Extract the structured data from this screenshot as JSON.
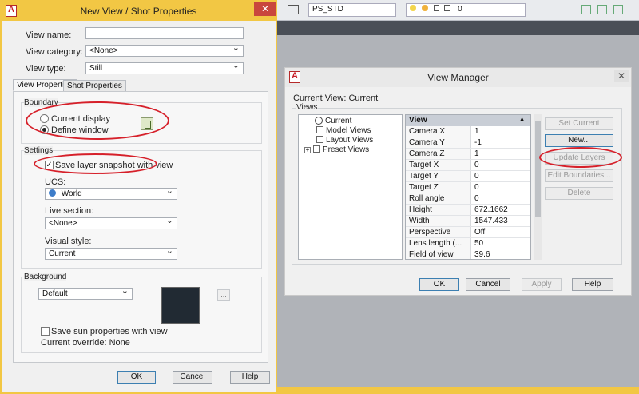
{
  "background": {
    "toolbar": {
      "layer_name": "PS_STD",
      "layer_value": "0"
    }
  },
  "new_view_dialog": {
    "title": "New View / Shot Properties",
    "close": "✕",
    "view_name_label": "View name:",
    "view_name_value": "",
    "view_category_label": "View category:",
    "view_category_value": "<None>",
    "view_type_label": "View type:",
    "view_type_value": "Still",
    "tabs": [
      "View Properties",
      "Shot Properties"
    ],
    "boundary": {
      "title": "Boundary",
      "current_display": "Current display",
      "define_window": "Define window"
    },
    "settings": {
      "title": "Settings",
      "save_layer_snapshot": "Save layer snapshot with view",
      "ucs_label": "UCS:",
      "ucs_value": "World",
      "live_section_label": "Live section:",
      "live_section_value": "<None>",
      "visual_style_label": "Visual style:",
      "visual_style_value": "Current"
    },
    "background": {
      "title": "Background",
      "type_value": "Default",
      "ellipsis": "...",
      "save_sun": "Save sun properties with view",
      "current_override": "Current override: None"
    },
    "buttons": {
      "ok": "OK",
      "cancel": "Cancel",
      "help": "Help"
    }
  },
  "view_manager": {
    "title": "View Manager",
    "close": "✕",
    "current_view": "Current View: Current",
    "views_label": "Views",
    "tree": [
      "Current",
      "Model Views",
      "Layout Views",
      "Preset Views"
    ],
    "tree_expander": "+",
    "grid_header": "View",
    "properties": [
      {
        "key": "Camera X",
        "value": "1"
      },
      {
        "key": "Camera Y",
        "value": "-1"
      },
      {
        "key": "Camera Z",
        "value": "1"
      },
      {
        "key": "Target X",
        "value": "0"
      },
      {
        "key": "Target Y",
        "value": "0"
      },
      {
        "key": "Target Z",
        "value": "0"
      },
      {
        "key": "Roll angle",
        "value": "0"
      },
      {
        "key": "Height",
        "value": "672.1662"
      },
      {
        "key": "Width",
        "value": "1547.433"
      },
      {
        "key": "Perspective",
        "value": "Off"
      },
      {
        "key": "Lens length (...",
        "value": "50"
      },
      {
        "key": "Field of view",
        "value": "39.6"
      }
    ],
    "side_buttons": [
      "Set Current",
      "New...",
      "Update Layers",
      "Edit Boundaries...",
      "Delete"
    ],
    "buttons": {
      "ok": "OK",
      "cancel": "Cancel",
      "apply": "Apply",
      "help": "Help"
    }
  }
}
